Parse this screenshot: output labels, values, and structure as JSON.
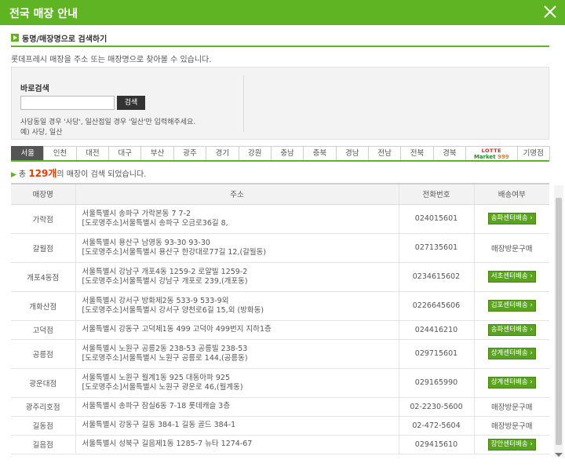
{
  "window": {
    "title": "전국 매장 안내"
  },
  "section": {
    "heading": "동명/매장명으로 검색하기"
  },
  "description": "롯데프레시 매장을 주소 또는 매장명으로 찾아볼 수 있습니다.",
  "search": {
    "label": "바로검색",
    "input_value": "",
    "button": "검색",
    "hint_line1": "사당동일 경우 '사당', 일산점일 경우 '일산'만 입력해주세요.",
    "hint_line2": "예) 사당, 일산"
  },
  "regions": [
    "서울",
    "인천",
    "대전",
    "대구",
    "부산",
    "광주",
    "경기",
    "강원",
    "충남",
    "충북",
    "경남",
    "전남",
    "전북",
    "경북",
    "",
    "기명점"
  ],
  "active_region": "서울",
  "lotte_tab": {
    "line1": "LOTTE",
    "line2a": "Market",
    "line2b": "999"
  },
  "result": {
    "prefix": "총 ",
    "count": "129개",
    "suffix": "의 매장이 검색 되었습니다."
  },
  "table": {
    "headers": [
      "매장명",
      "주소",
      "전화번호",
      "배송여부"
    ],
    "rows": [
      {
        "name": "가락점",
        "addr1": "서울특별시 송파구 가락본동 7 7-2",
        "addr2": "[도로명주소]서울특별시 송파구 오금로36길 8,",
        "phone": "024015601",
        "delivery": "송파센터배송",
        "delivery_type": "badge"
      },
      {
        "name": "갈월점",
        "addr1": "서울특별시 용산구 남영동 93-30 93-30",
        "addr2": "[도로명주소]서울특별시 용산구 한강대로77길 12,(갈월동)",
        "phone": "027135601",
        "delivery": "매장방문구매",
        "delivery_type": "plain"
      },
      {
        "name": "개포4동점",
        "addr1": "서울특별시 강남구 개포4동 1259-2 로얄빌 1259-2",
        "addr2": "[도로명주소]서울특별시 강남구 개포로 239,(개포동)",
        "phone": "0234615602",
        "delivery": "서초센터배송",
        "delivery_type": "badge"
      },
      {
        "name": "개화산점",
        "addr1": "서울특별시 강서구 방화제2동 533-9 533-9외",
        "addr2": "[도로명주소]서울특별시 강서구 양천로6길 15,외 (방화동)",
        "phone": "0226645606",
        "delivery": "김포센터배송",
        "delivery_type": "badge"
      },
      {
        "name": "고덕점",
        "addr1": "서울특별시 강동구 고덕제1동 499 고덕아 499번지 지하1층",
        "addr2": "",
        "phone": "024416210",
        "delivery": "송파센터배송",
        "delivery_type": "badge"
      },
      {
        "name": "공릉점",
        "addr1": "서울특별시 노원구 공릉2동 238-53 공릉빌 238-53",
        "addr2": "[도로명주소]서울특별시 노원구 공릉로 144,(공릉동)",
        "phone": "029715601",
        "delivery": "상계센터배송",
        "delivery_type": "badge"
      },
      {
        "name": "광운대점",
        "addr1": "서울특별시 노원구 월계1동 925 대동아파 925",
        "addr2": "[도로명주소]서울특별시 노원구 광운로 46,(월계동)",
        "phone": "029165990",
        "delivery": "상계센터배송",
        "delivery_type": "badge"
      },
      {
        "name": "광주리호점",
        "addr1": "서울특별시 송파구 잠실6동 7-18 롯데캐슬 3층",
        "addr2": "",
        "phone": "02-2230-5600",
        "delivery": "매장방문구매",
        "delivery_type": "plain"
      },
      {
        "name": "길동점",
        "addr1": "서울특별시 강동구 길동 384-1 길동 골드 384-1",
        "addr2": "",
        "phone": "02-472-5604",
        "delivery": "매장방문구매",
        "delivery_type": "plain"
      },
      {
        "name": "길음점",
        "addr1": "서울특별시 성북구 길음제1동 1285-7 뉴타 1274-67",
        "addr2": "",
        "phone": "029415610",
        "delivery": "장안센터배송",
        "delivery_type": "badge"
      }
    ]
  },
  "colors": {
    "brand_green": "#5fb424",
    "badge_green": "#5aa31e",
    "count_red": "#e03b00"
  },
  "icons": {
    "close": "close-icon",
    "section_bullet": "arrow-bullet-icon",
    "badge_arrow": "chevron-right-icon"
  }
}
